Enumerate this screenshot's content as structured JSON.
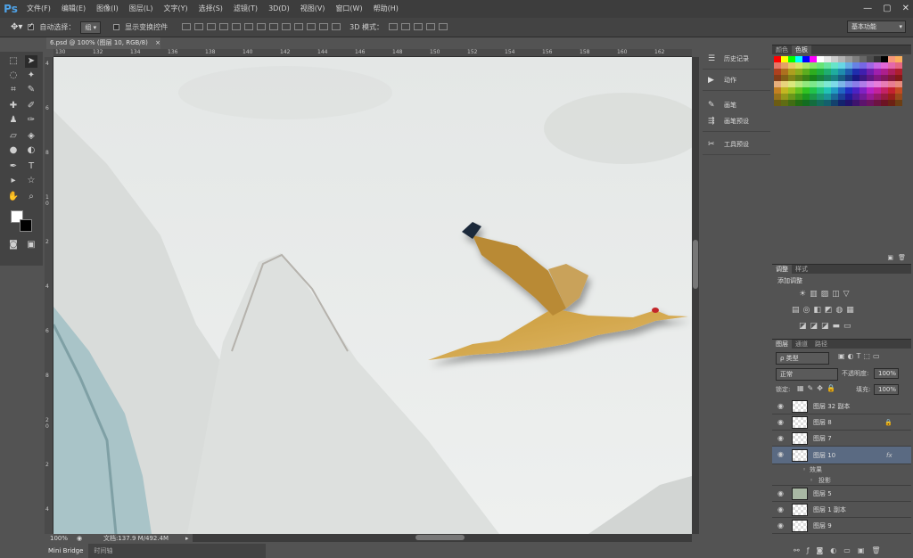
{
  "app": {
    "logo": "Ps"
  },
  "menu": [
    "文件(F)",
    "编辑(E)",
    "图像(I)",
    "图层(L)",
    "文字(Y)",
    "选择(S)",
    "滤镜(T)",
    "3D(D)",
    "视图(V)",
    "窗口(W)",
    "帮助(H)"
  ],
  "window_controls": [
    "—",
    "▢",
    "✕"
  ],
  "options": {
    "auto_select_label": "自动选择：",
    "auto_select_value": "组",
    "show_transform_label": "显示变换控件",
    "mode_3d_label": "3D 模式：",
    "workspace": "基本功能"
  },
  "document": {
    "tab_title": "6.psd @ 100% (图层 10, RGB/8)",
    "close": "×",
    "zoom": "100%",
    "doc_info": "文档:137.9 M/492.4M"
  },
  "ruler_top": [
    "130",
    "132",
    "134",
    "136",
    "138",
    "140",
    "142",
    "144",
    "146",
    "148",
    "150",
    "152",
    "154",
    "156",
    "158",
    "160",
    "162",
    "164"
  ],
  "ruler_left": [
    "4",
    "6",
    "8",
    "1\n0",
    "2",
    "4",
    "6",
    "8",
    "2\n0",
    "2",
    "4"
  ],
  "bottom_tabs": [
    "Mini Bridge",
    "时间轴"
  ],
  "mid_panel": [
    {
      "icon": "history-icon",
      "label": "历史记录"
    },
    {
      "icon": "actions-icon",
      "label": "动作"
    },
    {
      "icon": "brush-icon",
      "label": "画笔"
    },
    {
      "icon": "brush-presets-icon",
      "label": "画笔预设"
    },
    {
      "icon": "tool-presets-icon",
      "label": "工具预设"
    }
  ],
  "color_panel": {
    "tabs": [
      "颜色",
      "色板"
    ]
  },
  "adjust_panel": {
    "tabs": [
      "调整",
      "样式"
    ],
    "title": "添加调整"
  },
  "layers_panel": {
    "tabs": [
      "图层",
      "通道",
      "路径"
    ],
    "kind": "ρ 类型",
    "blend": "正常",
    "opacity_label": "不透明度:",
    "opacity_value": "100%",
    "lock_label": "锁定:",
    "fill_label": "填充:",
    "fill_value": "100%",
    "layers": [
      {
        "name": "图层 32 副本"
      },
      {
        "name": "图层 8"
      },
      {
        "name": "图层 7"
      },
      {
        "name": "图层 10",
        "fx": "fx"
      },
      {
        "name": "效果"
      },
      {
        "name": "投影"
      },
      {
        "name": "图层 5"
      },
      {
        "name": "图层 1 副本"
      },
      {
        "name": "图层 9"
      }
    ]
  },
  "colors": {
    "accent": "#4fa3e8",
    "selected_layer": "#5a6a82"
  }
}
